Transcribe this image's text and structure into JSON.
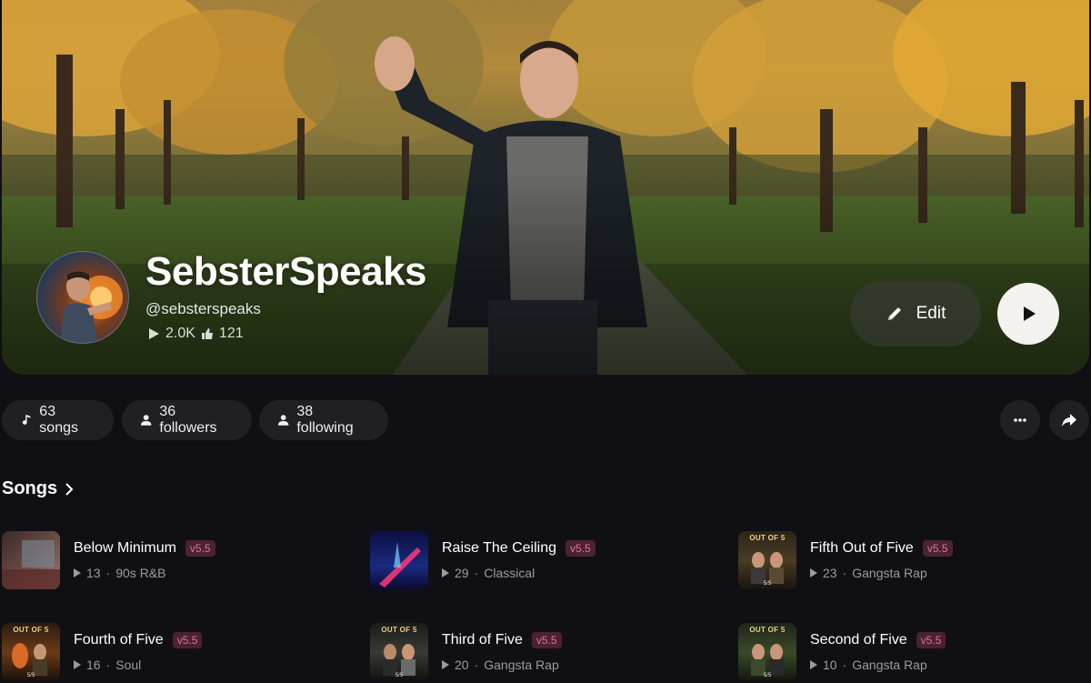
{
  "profile": {
    "name": "SebsterSpeaks",
    "handle": "@sebsterspeaks",
    "plays": "2.0K",
    "likes": "121"
  },
  "actions": {
    "edit_label": "Edit"
  },
  "pills": {
    "songs": "63 songs",
    "followers": "36 followers",
    "following": "38 following"
  },
  "songs_section": {
    "title": "Songs"
  },
  "songs": [
    {
      "title": "Below Minimum",
      "version": "v5.5",
      "plays": "13",
      "genre": "90s R&B"
    },
    {
      "title": "Raise The Ceiling",
      "version": "v5.5",
      "plays": "29",
      "genre": "Classical"
    },
    {
      "title": "Fifth Out of Five",
      "version": "v5.5",
      "plays": "23",
      "genre": "Gangsta Rap"
    },
    {
      "title": "Fourth of Five",
      "version": "v5.5",
      "plays": "16",
      "genre": "Soul"
    },
    {
      "title": "Third of Five",
      "version": "v5.5",
      "plays": "20",
      "genre": "Gangsta Rap"
    },
    {
      "title": "Second of Five",
      "version": "v5.5",
      "plays": "10",
      "genre": "Gangsta Rap"
    }
  ],
  "cover_art": {
    "series_text": "OUT OF 5",
    "series_foot": "5/5"
  },
  "colors": {
    "background": "#101014",
    "pill_bg": "#1f1f24",
    "badge_text": "#e0709a",
    "badge_bg": "#4a2233"
  }
}
